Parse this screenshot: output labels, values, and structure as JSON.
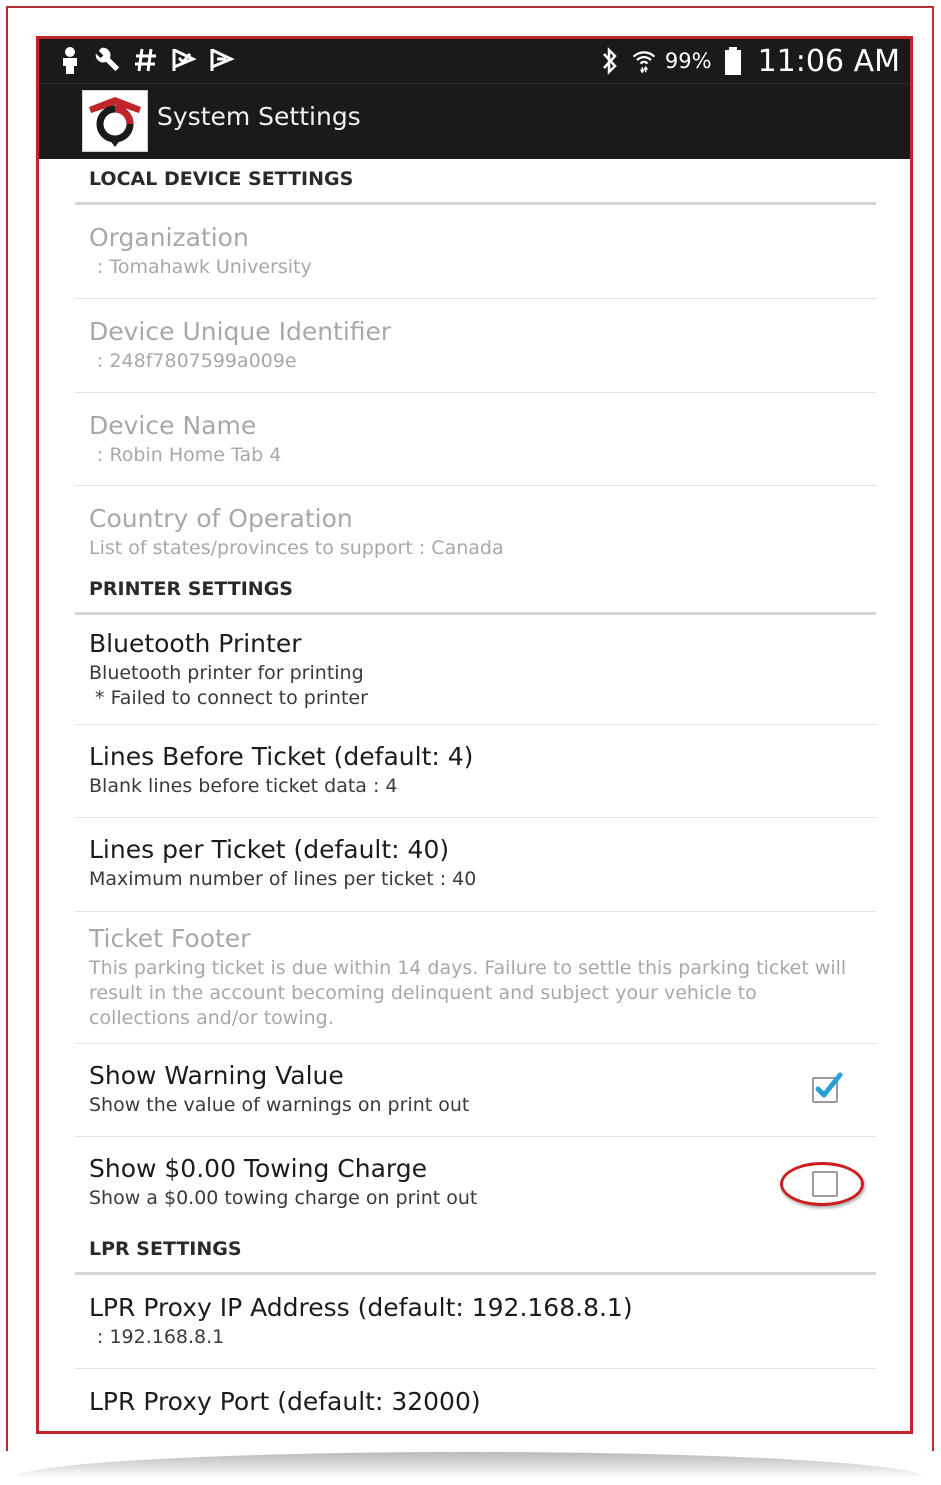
{
  "statusbar": {
    "battery_pct": "99%",
    "time": "11:06 AM"
  },
  "actionbar": {
    "title": "System Settings"
  },
  "sections": {
    "local": {
      "header": "LOCAL DEVICE SETTINGS",
      "organization": {
        "title": "Organization",
        "summary": ": Tomahawk University"
      },
      "device_id": {
        "title": "Device Unique Identifier",
        "summary": ": 248f7807599a009e"
      },
      "device_name": {
        "title": "Device Name",
        "summary": ": Robin Home Tab 4"
      },
      "country": {
        "title": "Country of Operation",
        "summary": "List of states/provinces to support : Canada"
      }
    },
    "printer": {
      "header": "PRINTER SETTINGS",
      "bt_printer": {
        "title": "Bluetooth Printer",
        "summary": "Bluetooth printer for printing",
        "status": " * Failed to connect to printer"
      },
      "lines_before": {
        "title": "Lines Before Ticket (default: 4)",
        "summary": "Blank lines before ticket data : 4"
      },
      "lines_per": {
        "title": "Lines per Ticket (default: 40)",
        "summary": "Maximum number of lines per ticket : 40"
      },
      "footer": {
        "title": "Ticket Footer",
        "summary": "This parking ticket is due within 14 days. Failure to settle this parking ticket will result in the account becoming delinquent and subject your vehicle to collections and/or towing."
      },
      "show_warning": {
        "title": "Show Warning Value",
        "summary": "Show the value of warnings on print out",
        "checked": true
      },
      "show_towing": {
        "title": "Show $0.00 Towing Charge",
        "summary": "Show a $0.00 towing charge on print out",
        "checked": false
      }
    },
    "lpr": {
      "header": "LPR SETTINGS",
      "proxy_ip": {
        "title": "LPR Proxy IP Address (default: 192.168.8.1)",
        "summary": ": 192.168.8.1"
      },
      "proxy_port": {
        "title": "LPR Proxy Port (default: 32000)"
      }
    }
  },
  "colors": {
    "frame_red": "#c0252a",
    "bar_dark": "#1a1a1a",
    "check_blue": "#2a9fd6",
    "annotation_red": "#cc2020"
  }
}
